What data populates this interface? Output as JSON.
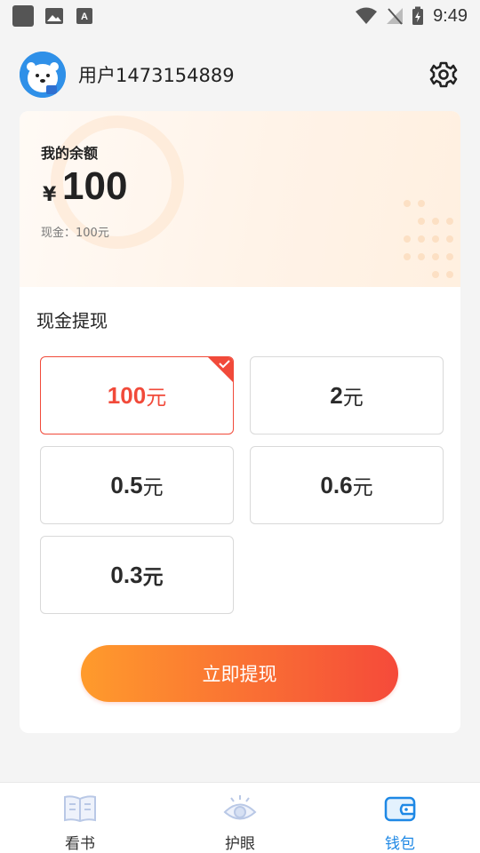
{
  "status_bar": {
    "time": "9:49"
  },
  "user": {
    "name": "用户1473154889"
  },
  "balance": {
    "title": "我的余额",
    "currency_symbol": "¥",
    "amount": "100",
    "cash_text": "现金：100元"
  },
  "withdraw": {
    "section_title": "现金提现",
    "options": [
      {
        "value": "100",
        "unit": "元",
        "selected": true
      },
      {
        "value": "2",
        "unit": "元",
        "selected": false
      },
      {
        "value": "0.5",
        "unit": "元",
        "selected": false
      },
      {
        "value": "0.6",
        "unit": "元",
        "selected": false
      },
      {
        "value": "0.3",
        "unit": "元",
        "selected": false
      }
    ],
    "button_label": "立即提现"
  },
  "nav": {
    "items": [
      {
        "label": "看书",
        "icon": "book-icon",
        "active": false
      },
      {
        "label": "护眼",
        "icon": "eye-icon",
        "active": false
      },
      {
        "label": "钱包",
        "icon": "wallet-icon",
        "active": true
      }
    ]
  },
  "colors": {
    "accent_red": "#f14a3a",
    "gradient_start": "#ff9b2c",
    "gradient_end": "#f54a3a",
    "nav_active": "#1e88e5"
  }
}
